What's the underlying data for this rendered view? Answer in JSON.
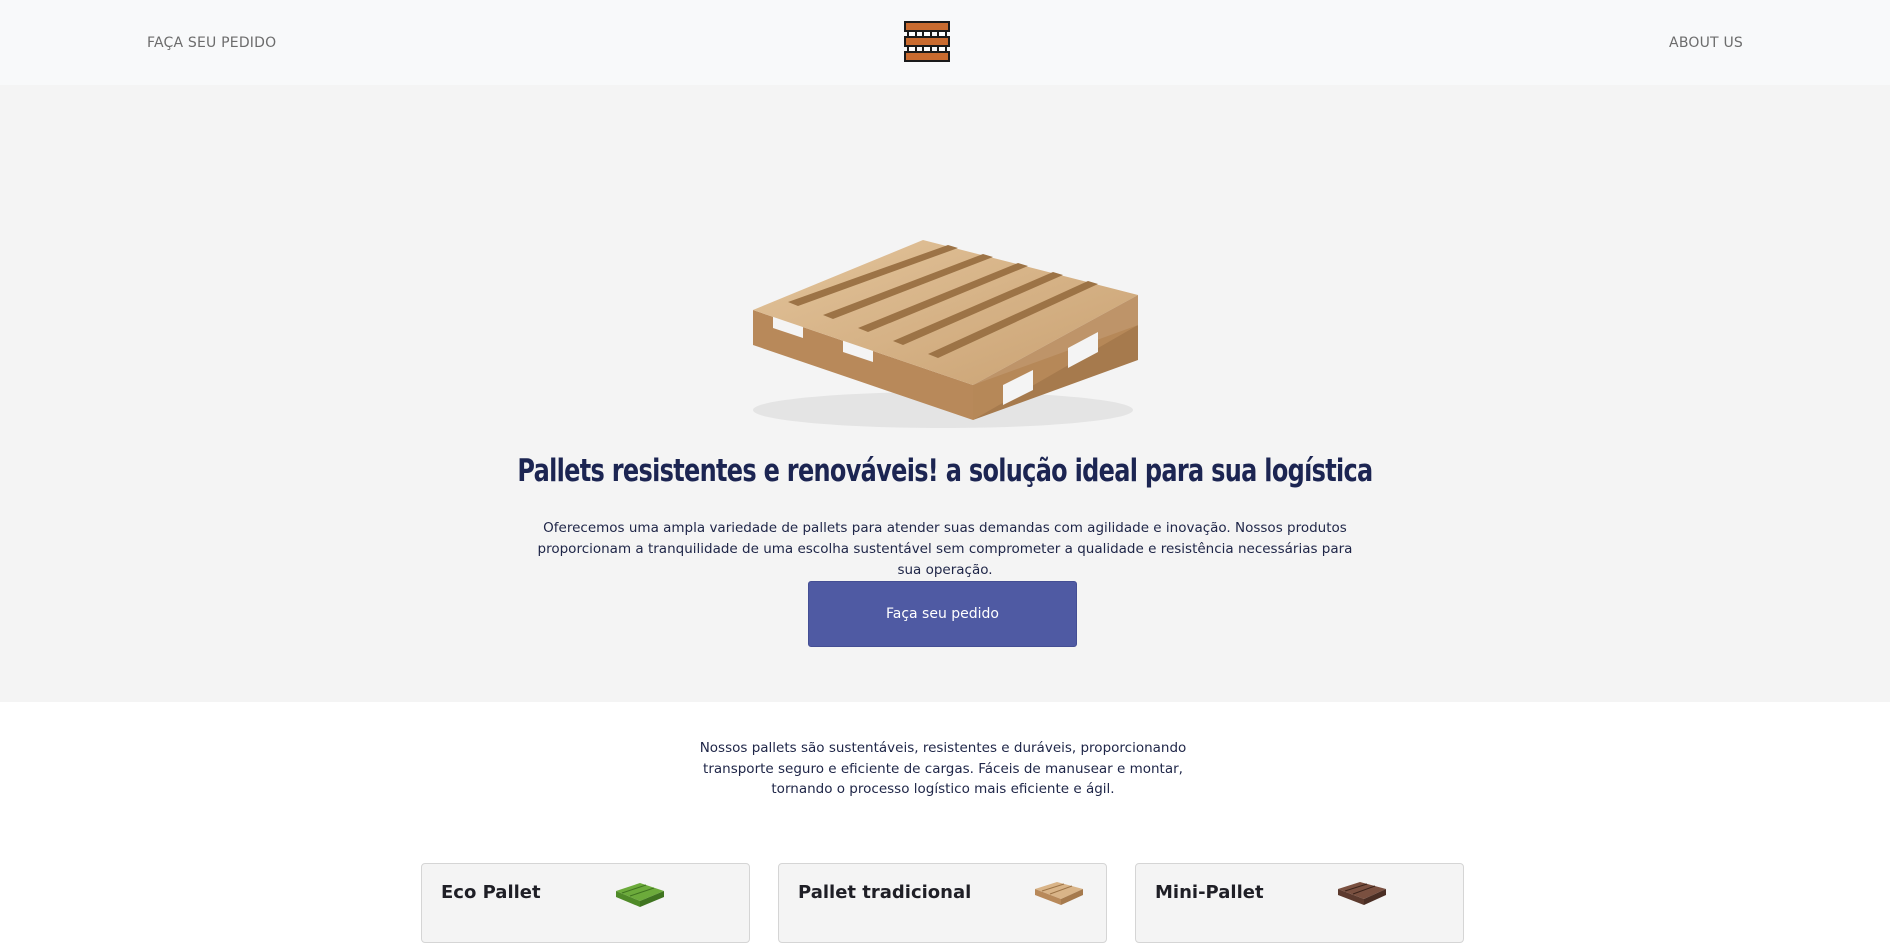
{
  "nav": {
    "left_link": "FAÇA SEU PEDIDO",
    "right_link": "ABOUT US",
    "logo_icon": "pallet-logo-icon"
  },
  "hero": {
    "image_icon": "wooden-pallet-image",
    "title": "Pallets resistentes e renováveis! a solução ideal para sua logística",
    "text": "Oferecemos uma ampla variedade de pallets para atender suas demandas com agilidade e inovação. Nossos produtos proporcionam a tranquilidade de uma escolha sustentável sem comprometer a qualidade e resistência necessárias para sua operação.",
    "button_label": "Faça seu pedido",
    "button_color": "#4f5aa3"
  },
  "intro": {
    "text": "Nossos pallets são sustentáveis, resistentes e duráveis, proporcionando transporte seguro e eficiente de cargas. Fáceis de manusear e montar, tornando o processo logístico mais eficiente e ágil."
  },
  "products": [
    {
      "title": "Eco Pallet",
      "icon": "green-eco-pallet-icon"
    },
    {
      "title": "Pallet tradicional",
      "icon": "wooden-pallet-icon"
    },
    {
      "title": "Mini-Pallet",
      "icon": "dark-mini-pallet-icon"
    }
  ]
}
